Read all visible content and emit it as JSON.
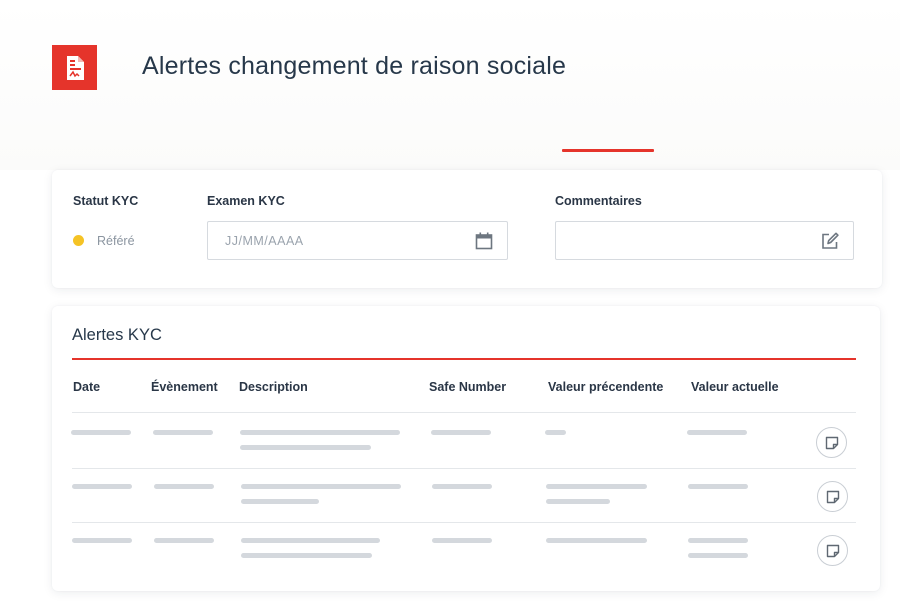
{
  "header": {
    "title": "Alertes changement de raison sociale",
    "logo_icon": "pdf-document-icon",
    "accent_color": "#e5342b"
  },
  "kyc": {
    "status_label": "Statut KYC",
    "status_value": "Référé",
    "status_color": "#f5c325",
    "exam_label": "Examen KYC",
    "exam_placeholder": "JJ/MM/AAAA",
    "exam_icon": "calendar-icon",
    "comments_label": "Commentaires",
    "comments_value": "",
    "comments_icon": "edit-icon"
  },
  "alerts": {
    "title": "Alertes KYC",
    "columns": [
      "Date",
      "Évènement",
      "Description",
      "Safe Number",
      "Valeur précendente",
      "Valeur actuelle"
    ],
    "rows": [
      {
        "action_icon": "note-icon"
      },
      {
        "action_icon": "note-icon"
      },
      {
        "action_icon": "note-icon"
      }
    ]
  }
}
